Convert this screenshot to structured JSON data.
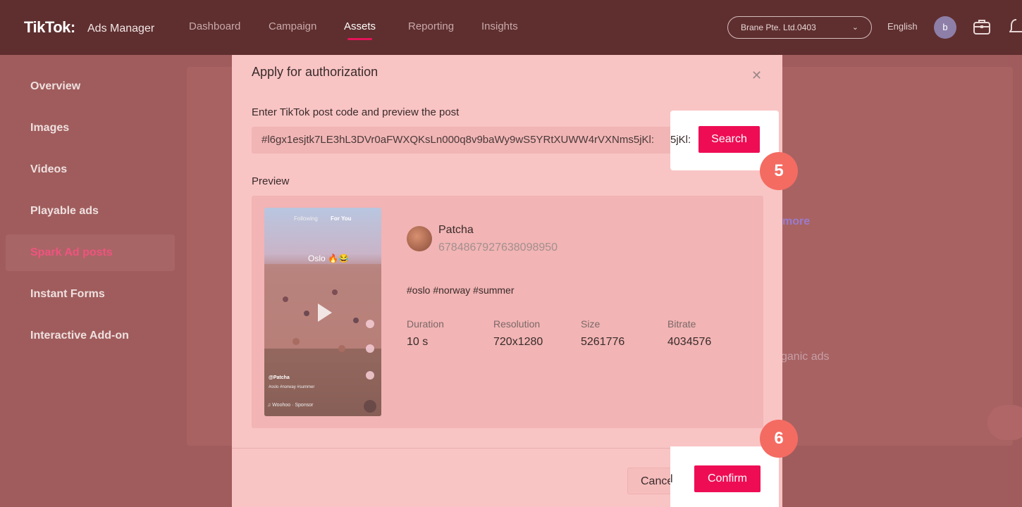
{
  "header": {
    "logo": "TikTok:",
    "logo_sub": "Ads Manager",
    "nav": [
      "Dashboard",
      "Campaign",
      "Assets",
      "Reporting",
      "Insights"
    ],
    "active_nav": "Assets",
    "account": "Brane Pte. Ltd.0403",
    "language": "English",
    "avatar_initial": "b"
  },
  "sidebar": {
    "items": [
      "Overview",
      "Images",
      "Videos",
      "Playable ads",
      "Spark Ad posts",
      "Instant Forms",
      "Interactive Add-on"
    ],
    "active": "Spark Ad posts"
  },
  "background": {
    "link_fragment": "more",
    "text_fragment": "ganic ads"
  },
  "modal": {
    "title": "Apply for authorization",
    "code_label": "Enter TikTok post code and preview the post",
    "code_value": "#l6gx1esjtk7LE3hL3DVr0aFWXQKsLn000q8v9baWy9wS5YRtXUWW4rVXNms5jKl:",
    "code_tail": "5jKl:",
    "search_label": "Search",
    "preview_label": "Preview",
    "post": {
      "thumb_tabs": [
        "Following",
        "For You"
      ],
      "thumb_caption": "Oslo 🔥😂",
      "thumb_user": "@Patcha",
      "thumb_tags": "#oslo #norway #summer",
      "thumb_music": "♫ Woohoo · Sponsor",
      "username": "Patcha",
      "user_id": "6784867927638098950",
      "hashtags": "#oslo #norway #summer",
      "duration_label": "Duration",
      "duration": "10 s",
      "resolution_label": "Resolution",
      "resolution": "720x1280",
      "size_label": "Size",
      "size": "5261776",
      "bitrate_label": "Bitrate",
      "bitrate": "4034576"
    },
    "cancel_label": "Cancel",
    "cancel_tail": "l",
    "confirm_label": "Confirm"
  },
  "steps": [
    "5",
    "6"
  ],
  "colors": {
    "accent": "#ee0d55",
    "badge": "#f46b62",
    "topbar": "#5f2f2f",
    "modal_bg": "#f9c4c4"
  }
}
